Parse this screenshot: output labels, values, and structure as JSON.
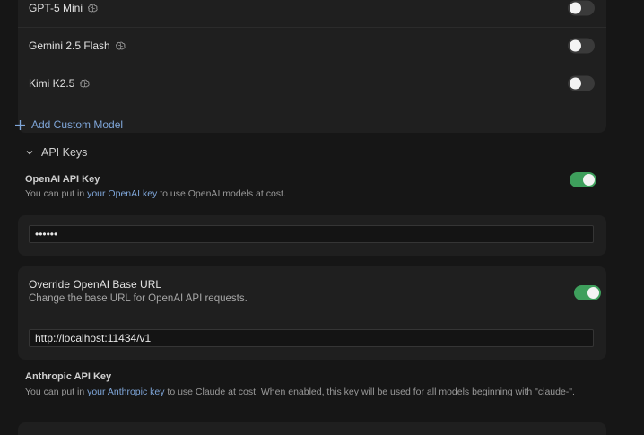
{
  "models": {
    "items": [
      {
        "name": "GPT-5 Mini",
        "enabled": false,
        "icon": "brain-icon"
      },
      {
        "name": "Gemini 2.5 Flash",
        "enabled": false,
        "icon": "brain-icon"
      },
      {
        "name": "Kimi K2.5",
        "enabled": false,
        "icon": "brain-icon"
      }
    ],
    "add_custom_label": "Add Custom Model"
  },
  "api_keys": {
    "section_title": "API Keys",
    "openai": {
      "title": "OpenAI API Key",
      "desc_prefix": "You can put in ",
      "desc_link": "your OpenAI key",
      "desc_suffix": " to use OpenAI models at cost.",
      "enabled": true,
      "value": "••••••"
    },
    "override": {
      "title": "Override OpenAI Base URL",
      "desc": "Change the base URL for OpenAI API requests.",
      "enabled": true,
      "value": "http://localhost:11434/v1"
    },
    "anthropic": {
      "title": "Anthropic API Key",
      "desc_prefix": "You can put in ",
      "desc_link": "your Anthropic key",
      "desc_suffix": " to use Claude at cost. When enabled, this key will be used for all models beginning with \"claude-\"."
    }
  },
  "colors": {
    "accent_toggle_on": "#3e9f5c",
    "link": "#7fa6d9",
    "background": "#161616",
    "card": "#1f1f1f"
  }
}
